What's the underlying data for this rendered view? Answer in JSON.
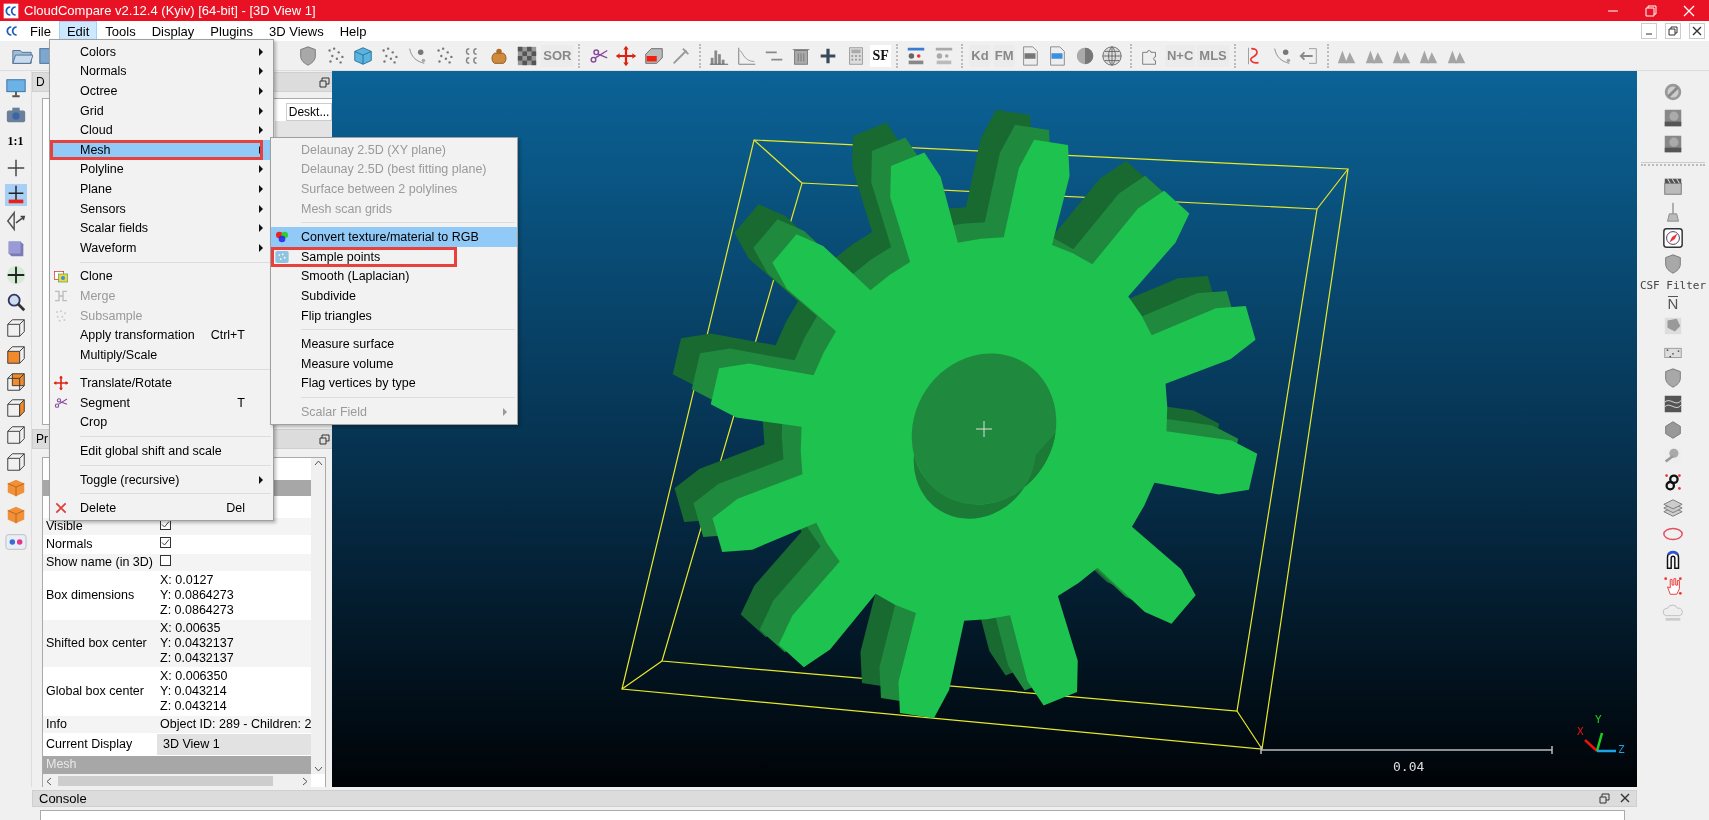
{
  "window": {
    "title": "CloudCompare v2.12.4 (Kyiv) [64-bit] - [3D View 1]"
  },
  "menu_bar": [
    {
      "label": "File",
      "selected": false
    },
    {
      "label": "Edit",
      "selected": true
    },
    {
      "label": "Tools",
      "selected": false
    },
    {
      "label": "Display",
      "selected": false
    },
    {
      "label": "Plugins",
      "selected": false
    },
    {
      "label": "3D Views",
      "selected": false
    },
    {
      "label": "Help",
      "selected": false
    }
  ],
  "toolbar_texts": [
    "SOR",
    "SF",
    "Kd",
    "FM",
    "N+C",
    "MLS"
  ],
  "left_toolbar_texts": [
    "1:1"
  ],
  "db_tree": {
    "title": "D",
    "column": "Deskt..."
  },
  "properties": {
    "title": "Pr",
    "rows": [
      {
        "kind": "check",
        "label": "Visible",
        "checked": true
      },
      {
        "kind": "check",
        "label": "Normals",
        "checked": true
      },
      {
        "kind": "check",
        "label": "Show name (in 3D)",
        "checked": false
      },
      {
        "kind": "lines",
        "label": "Box dimensions",
        "lines": [
          "X: 0.0127",
          "Y: 0.0864273",
          "Z: 0.0864273"
        ]
      },
      {
        "kind": "lines",
        "label": "Shifted box center",
        "lines": [
          "X: 0.00635",
          "Y: 0.0432137",
          "Z: 0.0432137"
        ]
      },
      {
        "kind": "lines",
        "label": "Global box center",
        "lines": [
          "X: 0.006350",
          "Y: 0.043214",
          "Z: 0.043214"
        ]
      },
      {
        "kind": "text",
        "label": "Info",
        "value": "Object ID: 289 - Children: 2"
      },
      {
        "kind": "combo",
        "label": "Current Display",
        "value": "3D View 1"
      },
      {
        "kind": "section",
        "label": "Mesh"
      }
    ]
  },
  "view": {
    "scale_label": "0.04",
    "axes": [
      "X",
      "Y",
      "Z"
    ]
  },
  "right_toolbar": {
    "csf_label": "CSF Filter",
    "normal_label": "N"
  },
  "console": {
    "title": "Console"
  },
  "edit_menu": {
    "items": [
      {
        "kind": "submenu",
        "label": "Colors",
        "selected": false,
        "disabled": false,
        "outlined": false
      },
      {
        "kind": "submenu",
        "label": "Normals",
        "selected": false,
        "disabled": false,
        "outlined": false
      },
      {
        "kind": "submenu",
        "label": "Octree",
        "selected": false,
        "disabled": false,
        "outlined": false
      },
      {
        "kind": "submenu",
        "label": "Grid",
        "selected": false,
        "disabled": false,
        "outlined": false
      },
      {
        "kind": "submenu",
        "label": "Cloud",
        "selected": false,
        "disabled": false,
        "outlined": false
      },
      {
        "kind": "submenu",
        "label": "Mesh",
        "selected": true,
        "disabled": false,
        "outlined": true
      },
      {
        "kind": "submenu",
        "label": "Polyline",
        "selected": false,
        "disabled": false,
        "outlined": false
      },
      {
        "kind": "submenu",
        "label": "Plane",
        "selected": false,
        "disabled": false,
        "outlined": false
      },
      {
        "kind": "submenu",
        "label": "Sensors",
        "selected": false,
        "disabled": false,
        "outlined": false
      },
      {
        "kind": "submenu",
        "label": "Scalar fields",
        "selected": false,
        "disabled": false,
        "outlined": false
      },
      {
        "kind": "submenu",
        "label": "Waveform",
        "selected": false,
        "disabled": false,
        "outlined": false
      },
      {
        "kind": "separator"
      },
      {
        "kind": "item",
        "label": "Clone",
        "selected": false,
        "disabled": false,
        "outlined": false
      },
      {
        "kind": "item",
        "label": "Merge",
        "selected": false,
        "disabled": true,
        "outlined": false
      },
      {
        "kind": "item",
        "label": "Subsample",
        "selected": false,
        "disabled": true,
        "outlined": false
      },
      {
        "kind": "item",
        "label": "Apply transformation",
        "shortcut": "Ctrl+T",
        "selected": false,
        "disabled": false,
        "outlined": false
      },
      {
        "kind": "item",
        "label": "Multiply/Scale",
        "selected": false,
        "disabled": false,
        "outlined": false
      },
      {
        "kind": "separator"
      },
      {
        "kind": "item",
        "label": "Translate/Rotate",
        "selected": false,
        "disabled": false,
        "outlined": false
      },
      {
        "kind": "item",
        "label": "Segment",
        "shortcut": "T",
        "selected": false,
        "disabled": false,
        "outlined": false
      },
      {
        "kind": "item",
        "label": "Crop",
        "selected": false,
        "disabled": false,
        "outlined": false
      },
      {
        "kind": "separator"
      },
      {
        "kind": "item",
        "label": "Edit global shift and scale",
        "selected": false,
        "disabled": false,
        "outlined": false
      },
      {
        "kind": "separator"
      },
      {
        "kind": "submenu",
        "label": "Toggle (recursive)",
        "selected": false,
        "disabled": false,
        "outlined": false
      },
      {
        "kind": "separator"
      },
      {
        "kind": "item",
        "label": "Delete",
        "shortcut": "Del",
        "selected": false,
        "disabled": false,
        "outlined": false
      }
    ]
  },
  "mesh_submenu": {
    "items": [
      {
        "kind": "item",
        "label": "Delaunay 2.5D (XY plane)",
        "selected": false,
        "disabled": true,
        "outlined": false
      },
      {
        "kind": "item",
        "label": "Delaunay 2.5D (best fitting plane)",
        "selected": false,
        "disabled": true,
        "outlined": false
      },
      {
        "kind": "item",
        "label": "Surface between 2 polylines",
        "selected": false,
        "disabled": true,
        "outlined": false
      },
      {
        "kind": "item",
        "label": "Mesh scan grids",
        "selected": false,
        "disabled": true,
        "outlined": false
      },
      {
        "kind": "separator"
      },
      {
        "kind": "item",
        "label": "Convert texture/material to RGB",
        "selected": true,
        "disabled": false,
        "outlined": false
      },
      {
        "kind": "item",
        "label": "Sample points",
        "selected": false,
        "disabled": false,
        "outlined": true
      },
      {
        "kind": "item",
        "label": "Smooth (Laplacian)",
        "selected": false,
        "disabled": false,
        "outlined": false
      },
      {
        "kind": "item",
        "label": "Subdivide",
        "selected": false,
        "disabled": false,
        "outlined": false
      },
      {
        "kind": "item",
        "label": "Flip triangles",
        "selected": false,
        "disabled": false,
        "outlined": false
      },
      {
        "kind": "separator"
      },
      {
        "kind": "item",
        "label": "Measure surface",
        "selected": false,
        "disabled": false,
        "outlined": false
      },
      {
        "kind": "item",
        "label": "Measure volume",
        "selected": false,
        "disabled": false,
        "outlined": false
      },
      {
        "kind": "item",
        "label": "Flag vertices by type",
        "selected": false,
        "disabled": false,
        "outlined": false
      },
      {
        "kind": "separator"
      },
      {
        "kind": "submenu",
        "label": "Scalar Field",
        "selected": false,
        "disabled": true,
        "outlined": false
      }
    ]
  }
}
